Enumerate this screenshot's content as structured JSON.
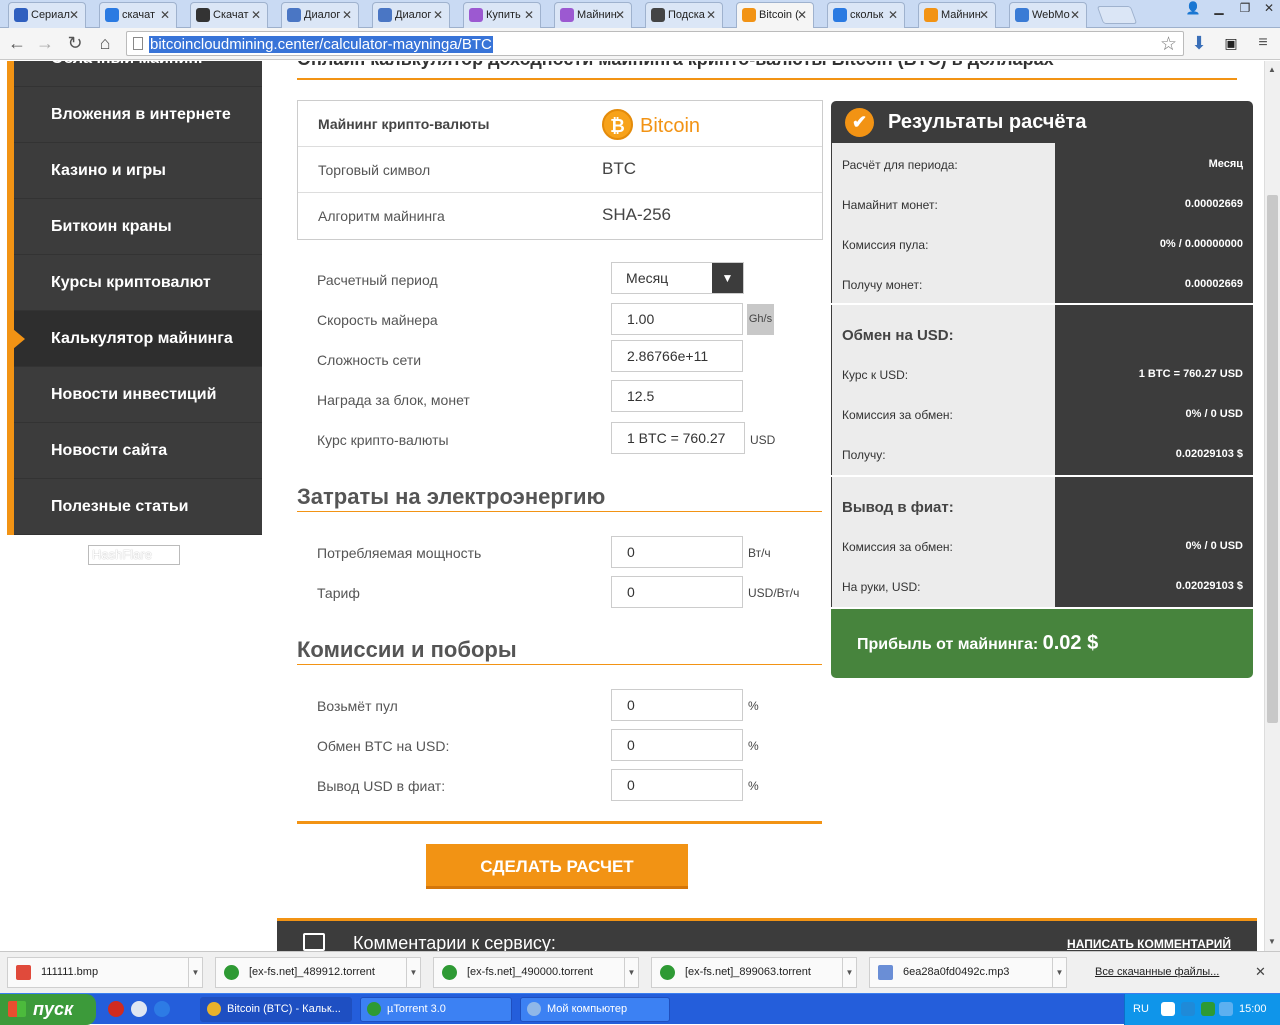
{
  "browser": {
    "tabs": [
      {
        "label": "Сериал",
        "icon": "bird-icon",
        "color": "#2f5fbf"
      },
      {
        "label": "скачат",
        "icon": "search-icon",
        "color": "#2a7ae2"
      },
      {
        "label": "Скачат",
        "icon": "film-icon",
        "color": "#333333"
      },
      {
        "label": "Диалог",
        "icon": "chat-icon",
        "color": "#4a76c4"
      },
      {
        "label": "Диалог",
        "icon": "chat-icon",
        "color": "#4a76c4"
      },
      {
        "label": "Купить",
        "icon": "puzzle-icon",
        "color": "#9c59d1"
      },
      {
        "label": "Майнин",
        "icon": "puzzle-icon",
        "color": "#9c59d1"
      },
      {
        "label": "Подска",
        "icon": "avatar-icon",
        "color": "#444444"
      },
      {
        "label": "Bitcoin (",
        "icon": "bitcoin-icon",
        "color": "#f29314"
      },
      {
        "label": "скольк",
        "icon": "search-icon",
        "color": "#2a7ae2"
      },
      {
        "label": "Майнин",
        "icon": "bitcoin-icon",
        "color": "#f29314"
      },
      {
        "label": "WebMo",
        "icon": "globe-icon",
        "color": "#3a7bd5"
      }
    ],
    "active_tab": 8,
    "url": "bitcoincloudmining.center/calculator-mayninga/BTC"
  },
  "sidebar": {
    "items": [
      {
        "label": "Облачный майнинг"
      },
      {
        "label": "Вложения в интернете"
      },
      {
        "label": "Казино и игры"
      },
      {
        "label": "Биткоин краны"
      },
      {
        "label": "Курсы криптовалют"
      },
      {
        "label": "Калькулятор майнинга"
      },
      {
        "label": "Новости инвестиций"
      },
      {
        "label": "Новости сайта"
      },
      {
        "label": "Полезные статьи"
      }
    ],
    "active_index": 5,
    "banner_alt": "HashFlare"
  },
  "page": {
    "title": "Онлайн калькулятор доходности майнинга крипто-валюты Bitcoin (BTC) в долларах"
  },
  "info": {
    "rows": [
      {
        "label": "Майнинг крипто-валюты",
        "value": "Bitcoin"
      },
      {
        "label": "Торговый символ",
        "value": "BTC"
      },
      {
        "label": "Алгоритм майнинга",
        "value": "SHA-256"
      }
    ],
    "coin_symbol": "₿"
  },
  "form": {
    "period_label": "Расчетный период",
    "period_value": "Месяц",
    "speed_label": "Скорость майнера",
    "speed_value": "1.00",
    "speed_unit": "Gh/s",
    "difficulty_label": "Сложность сети",
    "difficulty_value": "2.86766e+11",
    "reward_label": "Награда за блок, монет",
    "reward_value": "12.5",
    "rate_label": "Курс крипто-валюты",
    "rate_value": "1 BTC = 760.27",
    "rate_unit": "USD"
  },
  "energy": {
    "heading": "Затраты на электроэнергию",
    "power_label": "Потребляемая мощность",
    "power_value": "0",
    "power_unit": "Вт/ч",
    "tariff_label": "Тариф",
    "tariff_value": "0",
    "tariff_unit": "USD/Вт/ч"
  },
  "fees": {
    "heading": "Комиссии и поборы",
    "pool_label": "Возьмёт пул",
    "pool_value": "0",
    "exchange_label": "Обмен BTC на USD:",
    "exchange_value": "0",
    "withdraw_label": "Вывод USD в фиат:",
    "withdraw_value": "0",
    "unit": "%"
  },
  "calculate_button": "СДЕЛАТЬ РАСЧЕТ",
  "results": {
    "title": "Результаты расчёта",
    "block1": [
      {
        "label": "Расчёт для периода:",
        "value": "Месяц"
      },
      {
        "label": "Намайнит монет:",
        "value": "0.00002669"
      },
      {
        "label": "Комиссия пула:",
        "value": "0% / 0.00000000"
      },
      {
        "label": "Получу монет:",
        "value": "0.00002669"
      }
    ],
    "block2_title": "Обмен на USD:",
    "block2": [
      {
        "label": "Курс к USD:",
        "value": "1 BTC = 760.27 USD"
      },
      {
        "label": "Комиссия за обмен:",
        "value": "0% / 0 USD"
      },
      {
        "label": "Получу:",
        "value": "0.02029103 $"
      }
    ],
    "block3_title": "Вывод в фиат:",
    "block3": [
      {
        "label": "Комиссия за обмен:",
        "value": "0% / 0 USD"
      },
      {
        "label": "На руки, USD:",
        "value": "0.02029103 $"
      }
    ],
    "profit_label": "Прибыль от майнинга:",
    "profit_value": "0.02 $"
  },
  "comments": {
    "title": "Комментарии к сервису:",
    "link": "НАПИСАТЬ КОММЕНТАРИЙ"
  },
  "downloads": {
    "items": [
      {
        "name": "111111.bmp",
        "type": "bmp"
      },
      {
        "name": "[ex-fs.net]_489912.torrent",
        "type": "torrent"
      },
      {
        "name": "[ex-fs.net]_490000.torrent",
        "type": "torrent"
      },
      {
        "name": "[ex-fs.net]_899063.torrent",
        "type": "torrent"
      },
      {
        "name": "6ea28a0fd0492c.mp3",
        "type": "mp3"
      }
    ],
    "show_all": "Все скачанные файлы..."
  },
  "taskbar": {
    "start": "пуск",
    "tasks": [
      {
        "label": "Bitcoin (BTC) - Кальк...",
        "active": true
      },
      {
        "label": "µTorrent 3.0",
        "active": false
      },
      {
        "label": "Мой компьютер",
        "active": false
      }
    ],
    "lang": "RU",
    "time": "15:00"
  },
  "colors": {
    "accent": "#f29314",
    "dark": "#3c3c3c",
    "profit": "#47843d"
  }
}
